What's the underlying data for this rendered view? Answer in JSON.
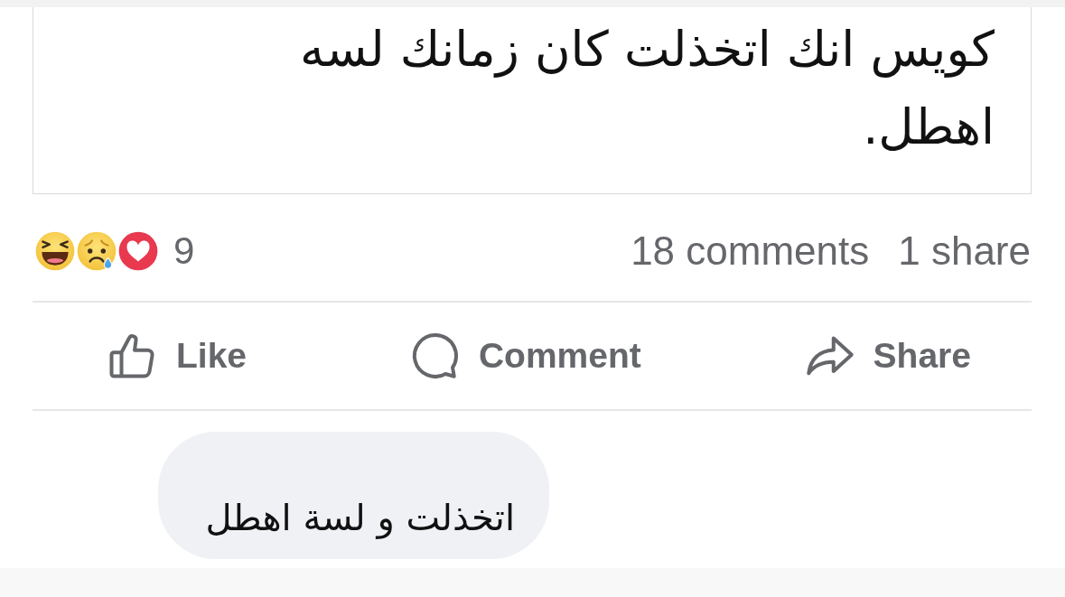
{
  "post": {
    "text": "كويس انك اتخذلت كان زمانك لسه اهطل."
  },
  "reactions": {
    "count": "9"
  },
  "stats": {
    "comments": "18 comments",
    "shares": "1 share"
  },
  "actions": {
    "like": {
      "label": "Like"
    },
    "comment": {
      "label": "Comment"
    },
    "share": {
      "label": "Share"
    }
  },
  "comment": {
    "text": "اتخذلت و لسة اهطل"
  }
}
